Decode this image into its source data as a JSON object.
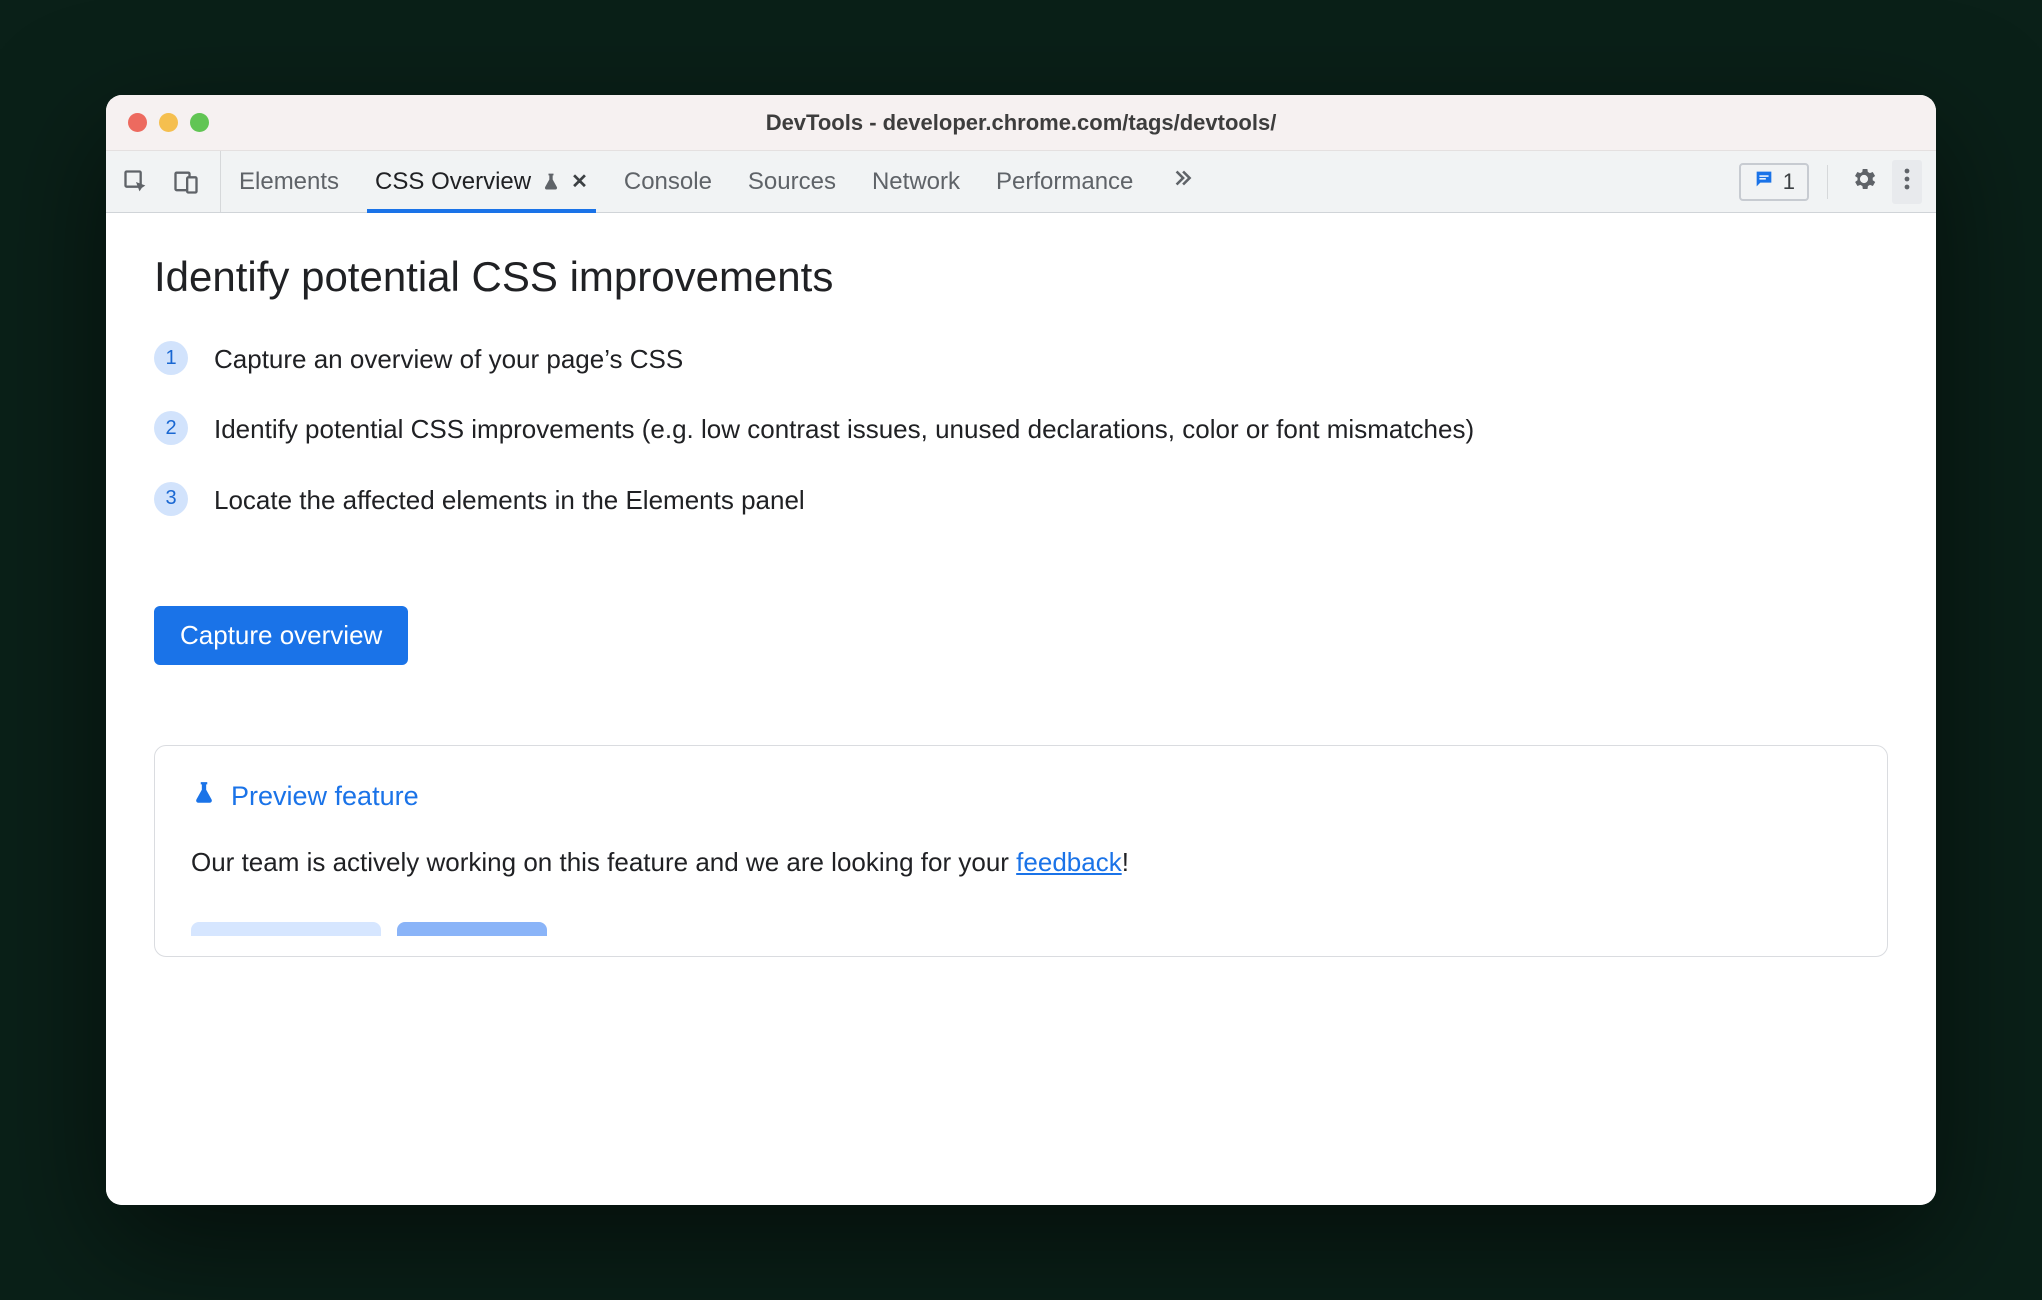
{
  "window": {
    "title": "DevTools - developer.chrome.com/tags/devtools/"
  },
  "tabs": {
    "items": [
      "Elements",
      "CSS Overview",
      "Console",
      "Sources",
      "Network",
      "Performance"
    ],
    "activeIndex": 1
  },
  "toolbar": {
    "issues_count": "1"
  },
  "main": {
    "heading": "Identify potential CSS improvements",
    "steps": [
      "Capture an overview of your page’s CSS",
      "Identify potential CSS improvements (e.g. low contrast issues, unused declarations, color or font mismatches)",
      "Locate the affected elements in the Elements panel"
    ],
    "capture_button": "Capture overview"
  },
  "preview": {
    "title": "Preview feature",
    "body_before": "Our team is actively working on this feature and we are looking for your ",
    "link_text": "feedback",
    "body_after": "!"
  }
}
